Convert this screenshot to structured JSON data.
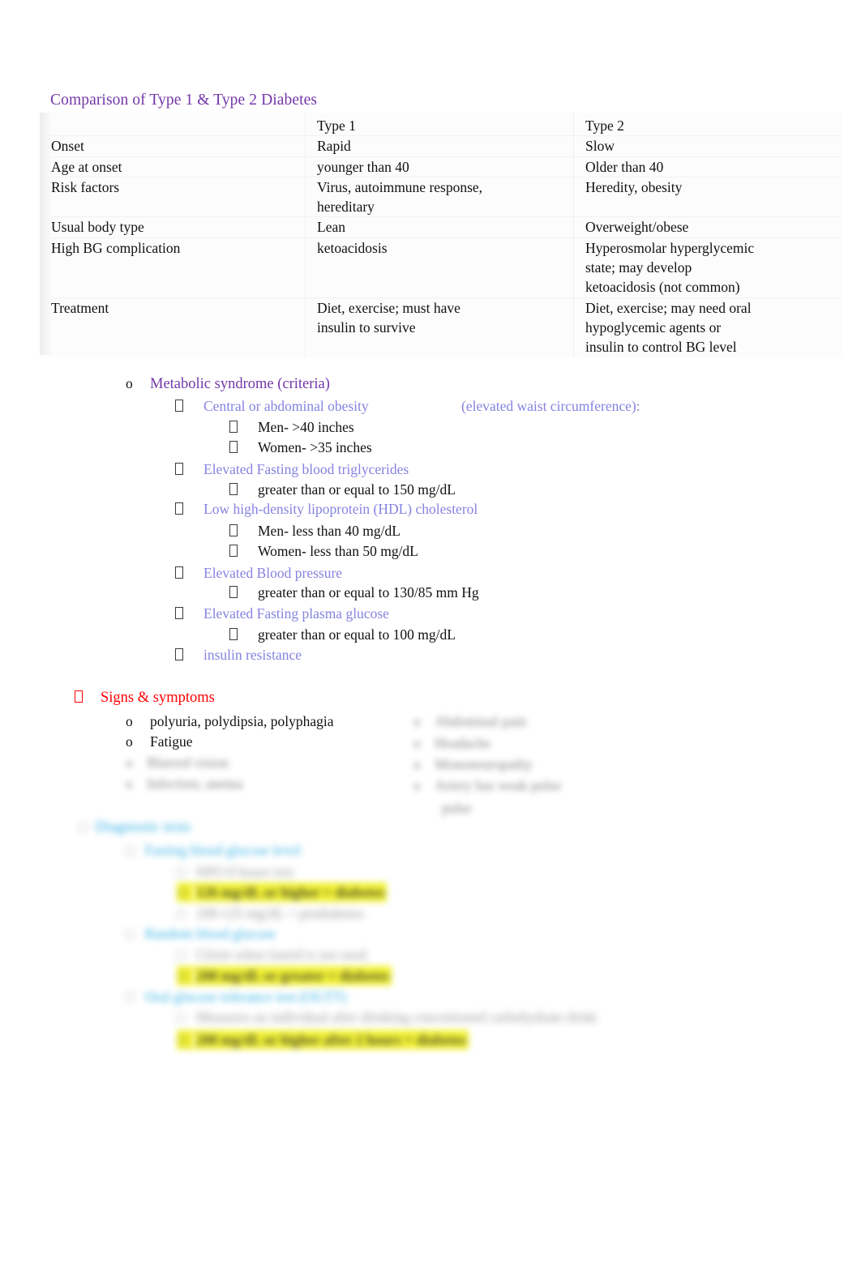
{
  "document": {
    "title": "Comparison of Type 1 & Type 2 Diabetes",
    "colors": {
      "title_purple": "#7337A8",
      "periwinkle": "#8583e0",
      "red": "#ff0000",
      "cyan": "#29ace3",
      "highlight_yellow": "#f2f22a",
      "body_black": "#111111"
    }
  },
  "comparison_table": {
    "columns": [
      "",
      "Type 1",
      "Type 2"
    ],
    "rows": [
      {
        "label": "",
        "type1": "Type 1",
        "type2": "Type 2"
      },
      {
        "label": "Onset",
        "type1": "Rapid",
        "type2": "Slow"
      },
      {
        "label": "Age at onset",
        "type1": "younger than 40",
        "type2": "Older than 40"
      },
      {
        "label": "Risk factors",
        "type1": "Virus, autoimmune response, hereditary",
        "type2": "Heredity, obesity"
      },
      {
        "label": "Usual body type",
        "type1": "Lean",
        "type2": "Overweight/obese"
      },
      {
        "label": "High BG complication",
        "type1": "ketoacidosis",
        "type2": "Hyperosmolar hyperglycemic state; may develop ketoacidosis (not common)"
      },
      {
        "label": "Treatment",
        "type1": "Diet, exercise; must have insulin to survive",
        "type2": "Diet, exercise; may need oral hypoglycemic agents or insulin to control BG level"
      }
    ],
    "cells": {
      "r0c1": "Type 1",
      "r0c2": "Type 2",
      "r1c0": "Onset",
      "r1c1": "Rapid",
      "r1c2": "Slow",
      "r2c0": "Age at onset",
      "r2c1": "younger than 40",
      "r2c2": "Older than 40",
      "r3c0": "Risk factors",
      "r3c1_l1": "Virus, autoimmune response,",
      "r3c1_l2": "hereditary",
      "r3c2": "Heredity, obesity",
      "r4c0": "Usual body type",
      "r4c1": "Lean",
      "r4c2": "Overweight/obese",
      "r5c0": "High BG complication",
      "r5c1": "ketoacidosis",
      "r5c2_l1": "Hyperosmolar hyperglycemic",
      "r5c2_l2": "state; may develop",
      "r5c2_l3": "ketoacidosis (not common)",
      "r6c0": "Treatment",
      "r6c1_l1": "Diet, exercise; must have",
      "r6c1_l2": "insulin to survive",
      "r6c2_l1": "Diet, exercise; may need oral",
      "r6c2_l2": "hypoglycemic agents or",
      "r6c2_l3": "insulin to control BG level"
    }
  },
  "metabolic_syndrome": {
    "heading": "Metabolic syndrome (criteria)",
    "heading_marker": "o",
    "criteria": [
      {
        "label": "Central or abdominal obesity",
        "note": "(elevated waist circumference):",
        "sub": [
          "Men- >40 inches",
          "Women- >35 inches"
        ]
      },
      {
        "label": "Elevated Fasting blood triglycerides",
        "note": "",
        "sub": [
          "greater than or equal to 150 mg/dL"
        ]
      },
      {
        "label": "Low high-density lipoprotein (HDL) cholesterol",
        "note": "",
        "sub": [
          "Men- less than 40 mg/dL",
          "Women- less than 50 mg/dL"
        ]
      },
      {
        "label": "Elevated Blood pressure",
        "note": "",
        "sub": [
          "greater than or equal to 130/85 mm Hg"
        ]
      },
      {
        "label": "Elevated Fasting plasma glucose",
        "note": "",
        "sub": [
          "greater than or equal to 100 mg/dL"
        ]
      },
      {
        "label": "insulin resistance",
        "note": "",
        "sub": []
      }
    ],
    "items": {
      "c1_label": "Central or abdominal obesity",
      "c1_note": "(elevated waist circumference):",
      "c1_s1": "Men- >40 inches",
      "c1_s2": "Women- >35 inches",
      "c2_label": "Elevated Fasting blood triglycerides",
      "c2_s1": "greater than or equal to 150 mg/dL",
      "c3_label": "Low high-density lipoprotein (HDL) cholesterol",
      "c3_s1": "Men- less than 40 mg/dL",
      "c3_s2": "Women- less than 50 mg/dL",
      "c4_label": "Elevated Blood pressure",
      "c4_s1": "greater than or equal to 130/85 mm Hg",
      "c5_label": "Elevated Fasting plasma glucose",
      "c5_s1": "greater than or equal to 100 mg/dL",
      "c6_label": "insulin resistance"
    }
  },
  "signs_symptoms": {
    "heading": "Signs & symptoms",
    "visible_items": [
      "polyuria, polydipsia, polyphagia",
      "Fatigue"
    ],
    "items": {
      "s1": "polyuria, polydipsia, polyphagia",
      "s2": "Fatigue"
    },
    "obscured_left": [
      "Blurred vision",
      "Infection; anema"
    ],
    "obscured_right": [
      "Abdominal pain",
      "Headache",
      "Mononeuropathy",
      "Artery has weak pulse"
    ]
  },
  "diagnostic_tests": {
    "heading": "Diagnostic tests",
    "obscured": true,
    "sections": [
      {
        "heading": "Fasting blood glucose level",
        "lines": [
          "NPO 8 hours test"
        ],
        "highlight": "126 mg/dL or higher = diabetes",
        "trailing": "100-125 mg/dL = prediabetes"
      },
      {
        "heading": "Random blood glucose",
        "lines": [
          "Client when fasted is not used"
        ],
        "highlight": "200 mg/dL or greater = diabetes",
        "trailing": ""
      },
      {
        "heading": "Oral glucose tolerance test (OGTT)",
        "lines": [
          "Measures an individual after drinking concentrated carbohydrate drink"
        ],
        "highlight": "200 mg/dL or higher after 2 hours = diabetes",
        "trailing": ""
      }
    ]
  }
}
